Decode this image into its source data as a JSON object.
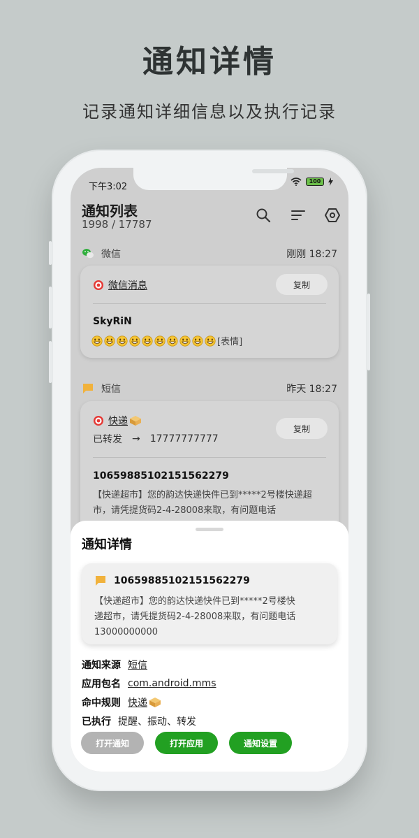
{
  "hero": {
    "title": "通知详情",
    "subtitle": "记录通知详细信息以及执行记录"
  },
  "status_bar": {
    "time": "下午3:02",
    "battery": "100"
  },
  "header": {
    "title": "通知列表",
    "count": "1998 / 17787",
    "icons": [
      "search-icon",
      "filter-icon",
      "settings-hex-icon"
    ]
  },
  "groups": [
    {
      "app": "微信",
      "time": "刚刚 18:27",
      "rule": "微信消息",
      "copy_label": "复制",
      "sender": "SkyRiN",
      "emoji_count": 10,
      "emoji_suffix": "[表情]"
    },
    {
      "app": "短信",
      "time": "昨天 18:27",
      "rule": "快递",
      "forward_label": "已转发",
      "forward_arrow": "→",
      "forward_to": "17777777777",
      "copy_label": "复制",
      "sender": "10659885102151562279",
      "message": "【快递超市】您的韵达快递快件已到*****2号楼快递超市，请凭提货码2-4-28008来取，有问题电话13000000000"
    }
  ],
  "sheet": {
    "title": "通知详情",
    "card": {
      "sender": "10659885102151562279",
      "message_line1": "【快递超市】您的韵达快递快件已到*****2号楼快",
      "message_line2": "递超市，请凭提货码2-4-28008来取，有问题电话",
      "message_line3": "13000000000"
    },
    "rows": [
      {
        "key": "通知来源",
        "value": "短信"
      },
      {
        "key": "应用包名",
        "value": "com.android.mms"
      },
      {
        "key": "命中规则",
        "value": "快递"
      },
      {
        "key": "已执行",
        "value": "提醒、振动、转发"
      }
    ],
    "buttons": {
      "open_notification": "打开通知",
      "open_app": "打开应用",
      "notification_settings": "通知设置"
    }
  },
  "colors": {
    "accent_green": "#22a022",
    "disabled_gray": "#b3b3b3",
    "background": "#c5cbca"
  }
}
